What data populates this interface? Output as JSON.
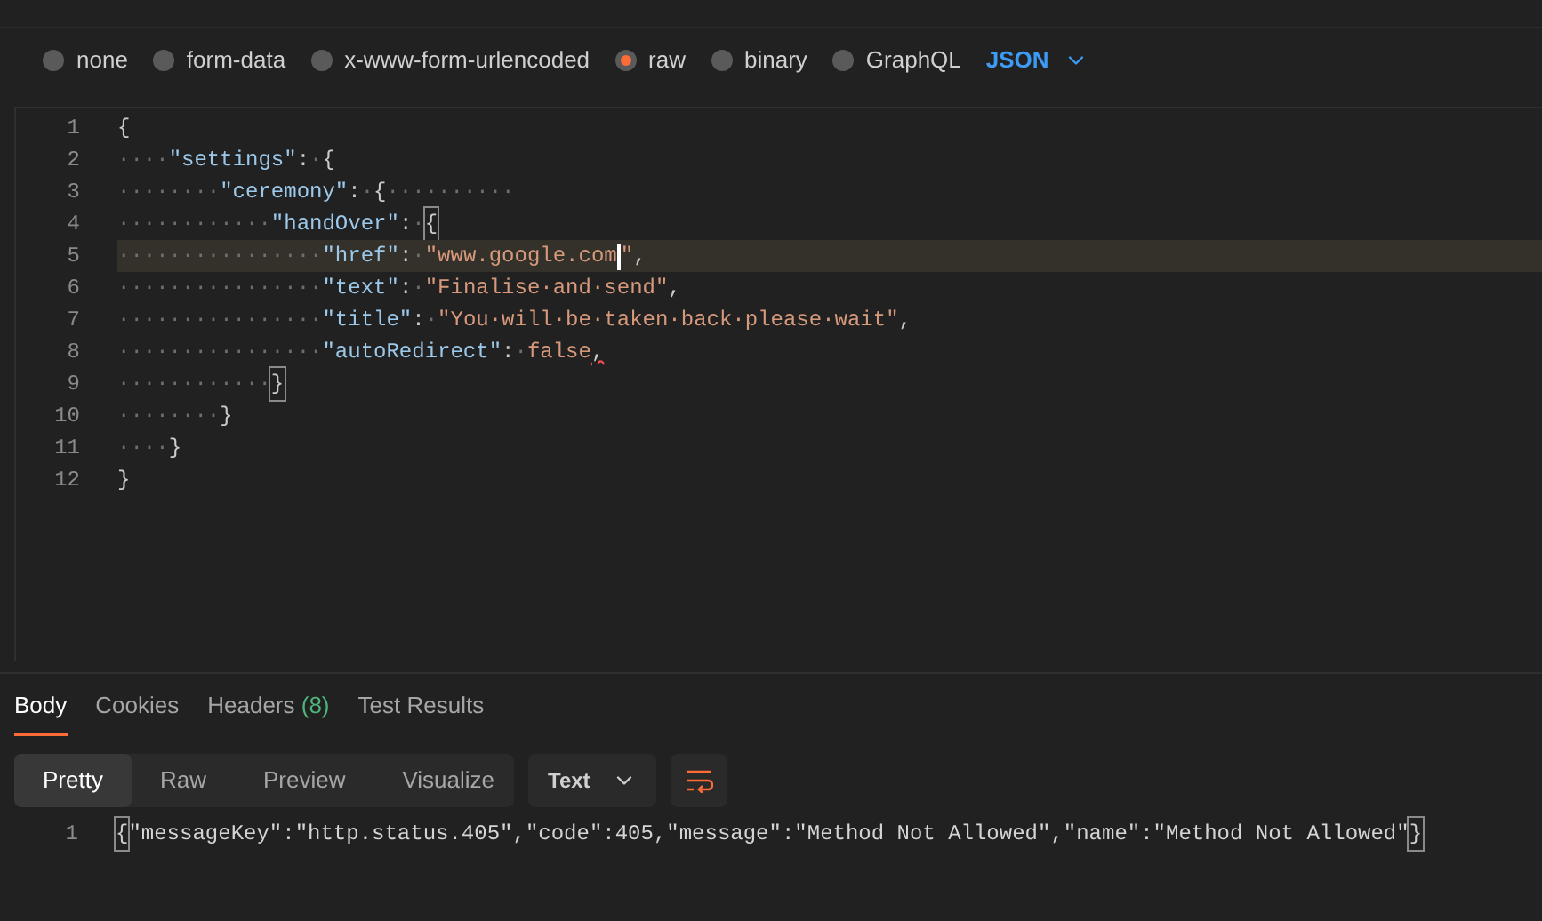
{
  "body_types": [
    {
      "label": "none",
      "selected": false
    },
    {
      "label": "form-data",
      "selected": false
    },
    {
      "label": "x-www-form-urlencoded",
      "selected": false
    },
    {
      "label": "raw",
      "selected": true
    },
    {
      "label": "binary",
      "selected": false
    },
    {
      "label": "GraphQL",
      "selected": false
    }
  ],
  "language_dropdown": {
    "label": "JSON"
  },
  "editor": {
    "lines": [
      {
        "number": "1",
        "highlighted": false,
        "tokens": [
          {
            "kind": "punct",
            "text": "{"
          }
        ]
      },
      {
        "number": "2",
        "highlighted": false,
        "tokens": [
          {
            "kind": "whitespace",
            "text": "····"
          },
          {
            "kind": "key",
            "text": "\"settings\""
          },
          {
            "kind": "punct",
            "text": ":"
          },
          {
            "kind": "whitespace",
            "text": "·"
          },
          {
            "kind": "punct",
            "text": "{"
          }
        ]
      },
      {
        "number": "3",
        "highlighted": false,
        "tokens": [
          {
            "kind": "whitespace",
            "text": "········"
          },
          {
            "kind": "key",
            "text": "\"ceremony\""
          },
          {
            "kind": "punct",
            "text": ":"
          },
          {
            "kind": "whitespace",
            "text": "·"
          },
          {
            "kind": "punct",
            "text": "{"
          },
          {
            "kind": "whitespace",
            "text": "··········"
          }
        ]
      },
      {
        "number": "4",
        "highlighted": false,
        "tokens": [
          {
            "kind": "whitespace",
            "text": "············"
          },
          {
            "kind": "key",
            "text": "\"handOver\""
          },
          {
            "kind": "punct",
            "text": ":"
          },
          {
            "kind": "whitespace",
            "text": "·"
          },
          {
            "kind": "punct",
            "text": "{",
            "matched": true
          }
        ]
      },
      {
        "number": "5",
        "highlighted": true,
        "tokens": [
          {
            "kind": "whitespace",
            "text": "················"
          },
          {
            "kind": "key",
            "text": "\"href\""
          },
          {
            "kind": "punct",
            "text": ":"
          },
          {
            "kind": "whitespace",
            "text": "·"
          },
          {
            "kind": "string",
            "text": "\"www.google.com",
            "cursor_after": true
          },
          {
            "kind": "string",
            "text": "\""
          },
          {
            "kind": "punct",
            "text": ","
          }
        ]
      },
      {
        "number": "6",
        "highlighted": false,
        "tokens": [
          {
            "kind": "whitespace",
            "text": "················"
          },
          {
            "kind": "key",
            "text": "\"text\""
          },
          {
            "kind": "punct",
            "text": ":"
          },
          {
            "kind": "whitespace",
            "text": "·"
          },
          {
            "kind": "string",
            "text": "\"Finalise·and·send\""
          },
          {
            "kind": "punct",
            "text": ","
          }
        ]
      },
      {
        "number": "7",
        "highlighted": false,
        "tokens": [
          {
            "kind": "whitespace",
            "text": "················"
          },
          {
            "kind": "key",
            "text": "\"title\""
          },
          {
            "kind": "punct",
            "text": ":"
          },
          {
            "kind": "whitespace",
            "text": "·"
          },
          {
            "kind": "string",
            "text": "\"You·will·be·taken·back·please·wait\""
          },
          {
            "kind": "punct",
            "text": ","
          }
        ]
      },
      {
        "number": "8",
        "highlighted": false,
        "tokens": [
          {
            "kind": "whitespace",
            "text": "················"
          },
          {
            "kind": "key",
            "text": "\"autoRedirect\""
          },
          {
            "kind": "punct",
            "text": ":"
          },
          {
            "kind": "whitespace",
            "text": "·"
          },
          {
            "kind": "boolean",
            "text": "false"
          },
          {
            "kind": "punct",
            "text": ",",
            "error": true
          }
        ]
      },
      {
        "number": "9",
        "highlighted": false,
        "tokens": [
          {
            "kind": "whitespace",
            "text": "············"
          },
          {
            "kind": "punct",
            "text": "}",
            "matched": true
          }
        ]
      },
      {
        "number": "10",
        "highlighted": false,
        "tokens": [
          {
            "kind": "whitespace",
            "text": "········"
          },
          {
            "kind": "punct",
            "text": "}"
          }
        ]
      },
      {
        "number": "11",
        "highlighted": false,
        "tokens": [
          {
            "kind": "whitespace",
            "text": "····"
          },
          {
            "kind": "punct",
            "text": "}"
          }
        ]
      },
      {
        "number": "12",
        "highlighted": false,
        "tokens": [
          {
            "kind": "punct",
            "text": "}"
          }
        ]
      }
    ]
  },
  "response_tabs": [
    {
      "label": "Body",
      "selected": true
    },
    {
      "label": "Cookies",
      "selected": false
    },
    {
      "label": "Headers",
      "count": "(8)",
      "selected": false
    },
    {
      "label": "Test Results",
      "selected": false
    }
  ],
  "view_modes": [
    {
      "label": "Pretty",
      "selected": true
    },
    {
      "label": "Raw",
      "selected": false
    },
    {
      "label": "Preview",
      "selected": false
    },
    {
      "label": "Visualize",
      "selected": false
    }
  ],
  "format_dropdown": {
    "label": "Text"
  },
  "response": {
    "lines": [
      {
        "number": "1",
        "tokens": [
          {
            "kind": "punct",
            "text": "{",
            "matched": true
          },
          {
            "kind": "text",
            "text": "\"messageKey\":\"http.status.405\",\"code\":405,\"message\":\"Method Not Allowed\",\"name\":\"Method Not Allowed\""
          },
          {
            "kind": "punct",
            "text": "}",
            "matched": true
          }
        ]
      }
    ]
  }
}
